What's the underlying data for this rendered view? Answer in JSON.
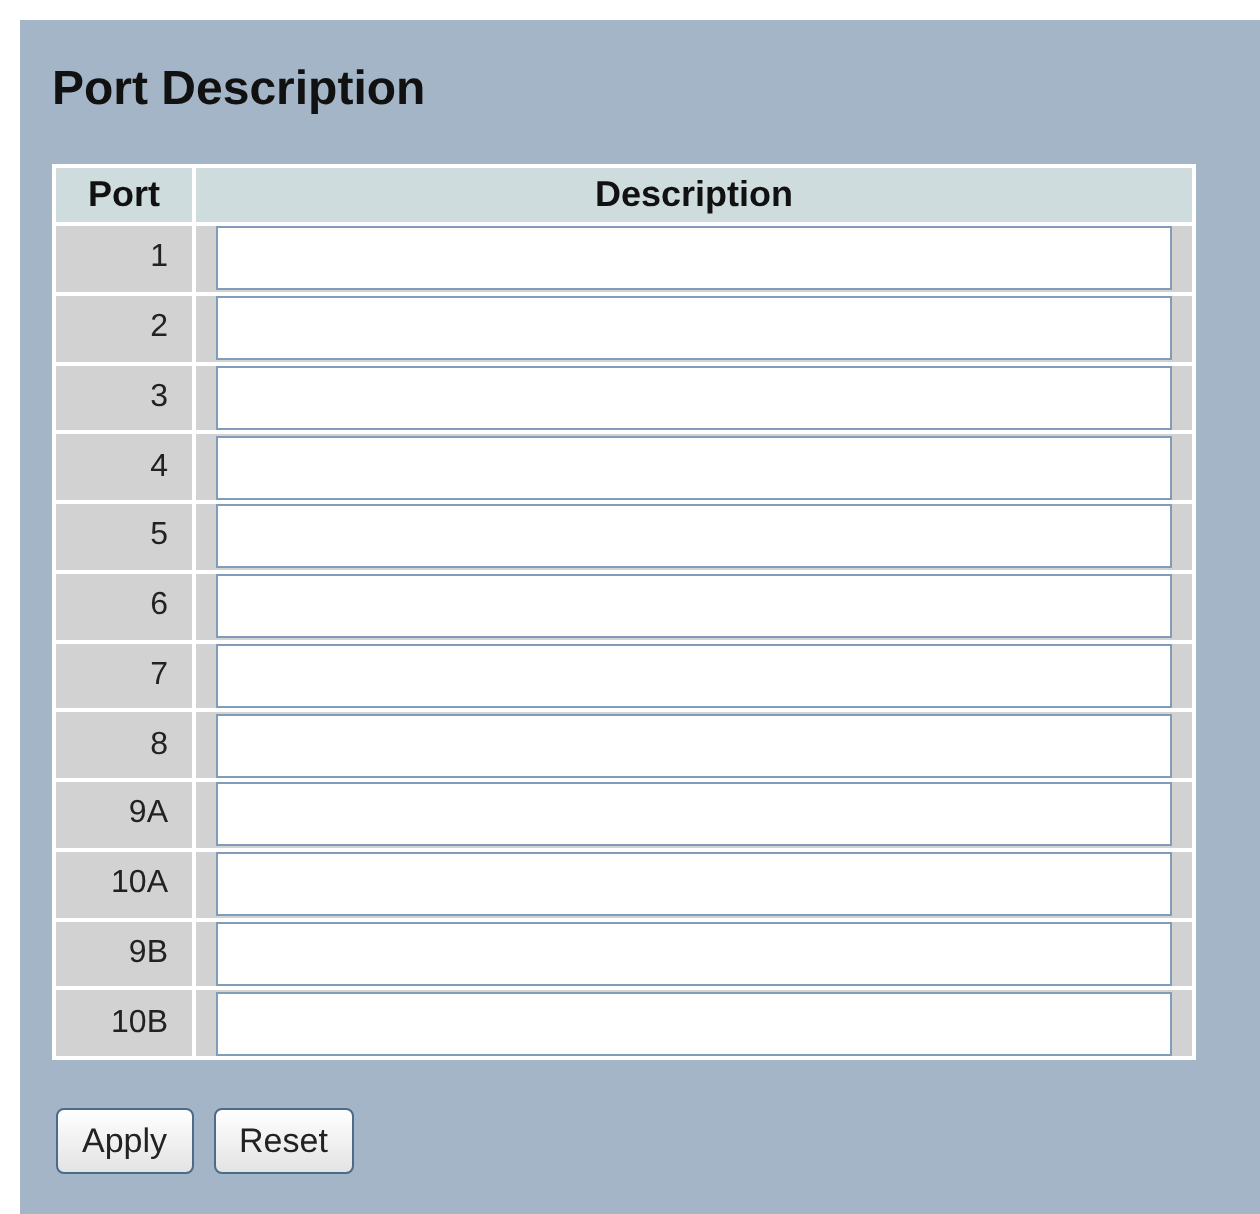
{
  "title": "Port Description",
  "table": {
    "columns": [
      "Port",
      "Description"
    ],
    "rows": [
      {
        "port": "1"
      },
      {
        "port": "2"
      },
      {
        "port": "3"
      },
      {
        "port": "4"
      },
      {
        "port": "5"
      },
      {
        "port": "6"
      },
      {
        "port": "7"
      },
      {
        "port": "8"
      },
      {
        "port": "9A"
      },
      {
        "port": "10A"
      },
      {
        "port": "9B"
      },
      {
        "port": "10B"
      }
    ]
  },
  "buttons": [
    "Apply",
    "Reset"
  ]
}
